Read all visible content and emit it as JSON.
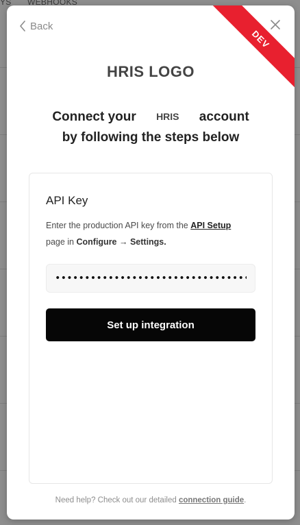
{
  "background": {
    "nav_left": "YS",
    "nav_webhooks": "WEBHOOKS"
  },
  "modal": {
    "back_label": "Back",
    "close_icon": "close-icon",
    "ribbon_label": "DEV",
    "logo_text": "HRIS LOGO",
    "heading_prefix": "Connect your",
    "heading_inline_logo": "HRIS",
    "heading_suffix": "account",
    "heading_line2": "by following the steps below"
  },
  "card": {
    "title": "API Key",
    "desc_prefix": "Enter the production API key from the ",
    "desc_link": "API Setup",
    "desc_mid": " page in ",
    "desc_path": "Configure → Settings.",
    "input_value": "••••••••••••••••••••••••••••••••••••••••",
    "submit_label": "Set up integration"
  },
  "footer": {
    "text": "Need help? Check out our detailed ",
    "link": "connection guide",
    "suffix": "."
  },
  "colors": {
    "ribbon": "#e8202f",
    "primary_button": "#060606",
    "backdrop": "#8e8e8e"
  }
}
